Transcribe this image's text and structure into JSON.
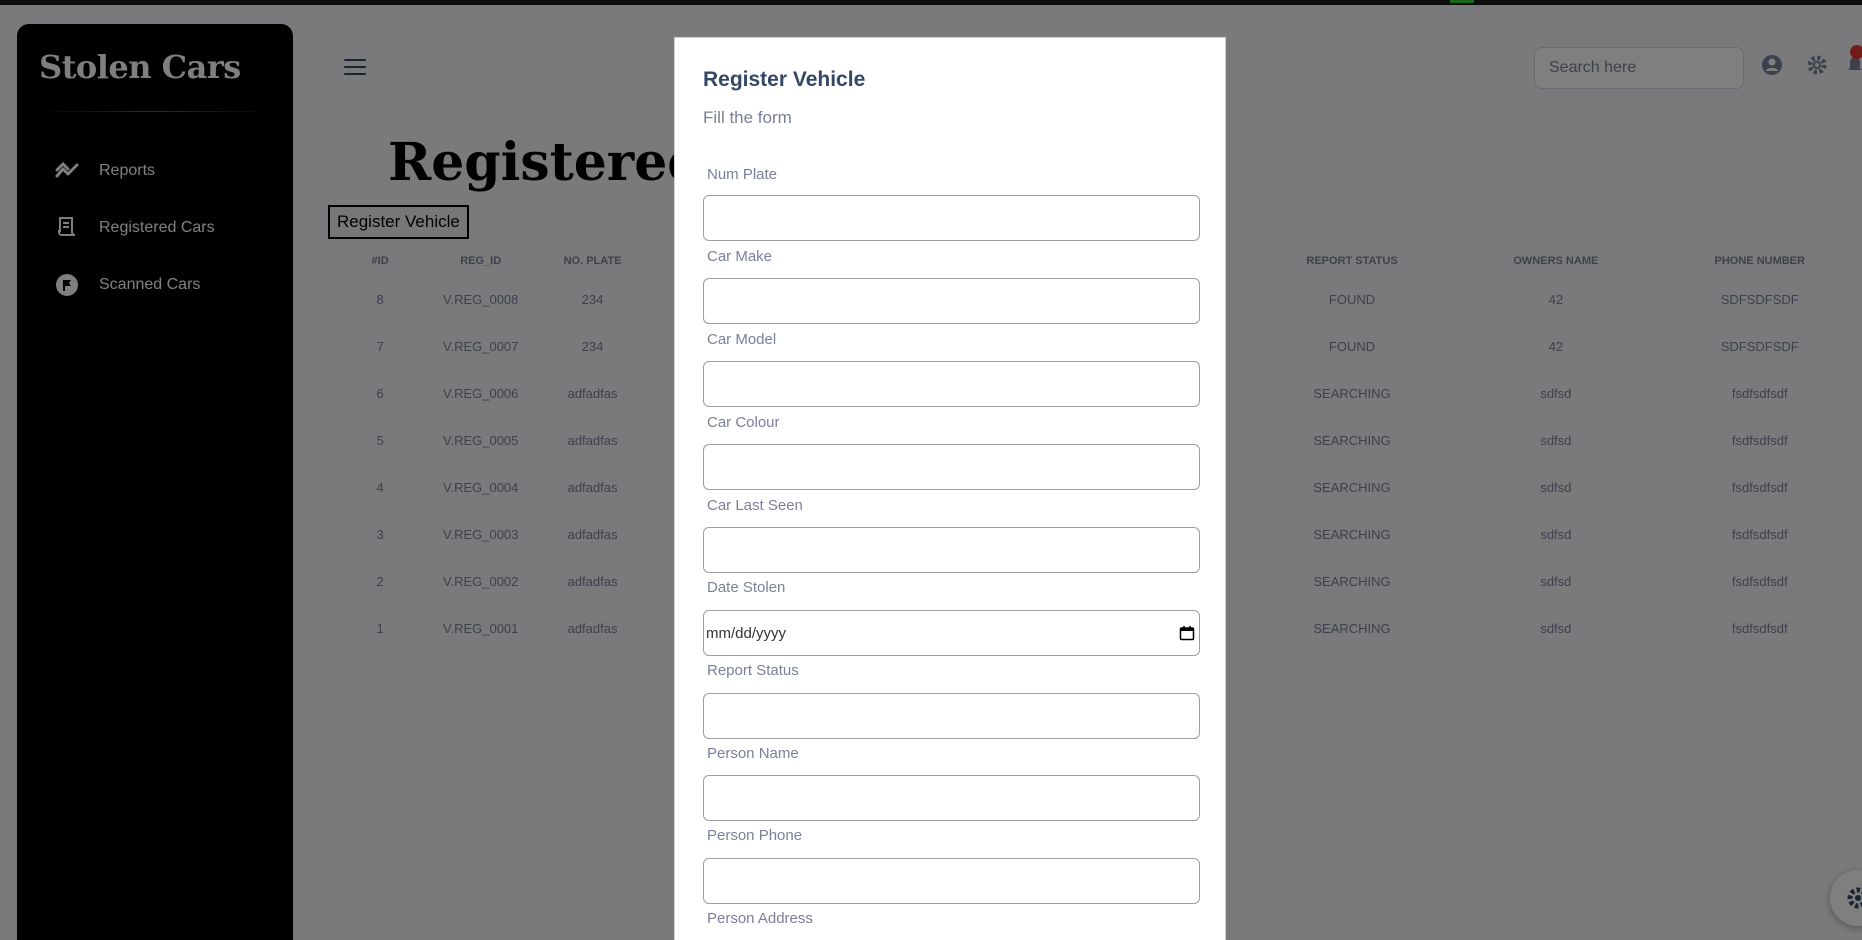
{
  "sidebar": {
    "brand": "Stolen Cars",
    "items": [
      {
        "label": "Reports",
        "icon": "chart-line-icon"
      },
      {
        "label": "Registered Cars",
        "icon": "receipt-icon"
      },
      {
        "label": "Scanned Cars",
        "icon": "flag-icon"
      }
    ]
  },
  "header": {
    "title": "Registered V",
    "register_button": "Register Vehicle",
    "search_placeholder": "Search here"
  },
  "table": {
    "columns": [
      "#ID",
      "REG_ID",
      "NO. PLATE",
      "REPORT STATUS",
      "OWNERS NAME",
      "PHONE NUMBER"
    ],
    "rows": [
      {
        "id": "8",
        "reg_id": "V.REG_0008",
        "plate": "234",
        "status": "FOUND",
        "owner": "42",
        "phone": "SDFSDFSDF"
      },
      {
        "id": "7",
        "reg_id": "V.REG_0007",
        "plate": "234",
        "status": "FOUND",
        "owner": "42",
        "phone": "SDFSDFSDF"
      },
      {
        "id": "6",
        "reg_id": "V.REG_0006",
        "plate": "adfadfas",
        "status": "SEARCHING",
        "owner": "sdfsd",
        "phone": "fsdfsdfsdf"
      },
      {
        "id": "5",
        "reg_id": "V.REG_0005",
        "plate": "adfadfas",
        "status": "SEARCHING",
        "owner": "sdfsd",
        "phone": "fsdfsdfsdf"
      },
      {
        "id": "4",
        "reg_id": "V.REG_0004",
        "plate": "adfadfas",
        "status": "SEARCHING",
        "owner": "sdfsd",
        "phone": "fsdfsdfsdf"
      },
      {
        "id": "3",
        "reg_id": "V.REG_0003",
        "plate": "adfadfas",
        "status": "SEARCHING",
        "owner": "sdfsd",
        "phone": "fsdfsdfsdf"
      },
      {
        "id": "2",
        "reg_id": "V.REG_0002",
        "plate": "adfadfas",
        "status": "SEARCHING",
        "owner": "sdfsd",
        "phone": "fsdfsdfsdf"
      },
      {
        "id": "1",
        "reg_id": "V.REG_0001",
        "plate": "adfadfas",
        "status": "SEARCHING",
        "owner": "sdfsd",
        "phone": "fsdfsdfsdf"
      }
    ]
  },
  "modal": {
    "title": "Register Vehicle",
    "subtitle": "Fill the form",
    "fields": [
      {
        "label": "Num Plate",
        "value": ""
      },
      {
        "label": "Car Make",
        "value": ""
      },
      {
        "label": "Car Model",
        "value": ""
      },
      {
        "label": "Car Colour",
        "value": ""
      },
      {
        "label": "Car Last Seen",
        "value": ""
      },
      {
        "label": "Date Stolen",
        "value": "mm/dd/yyyy"
      },
      {
        "label": "Report Status",
        "value": ""
      },
      {
        "label": "Person Name",
        "value": ""
      },
      {
        "label": "Person Phone",
        "value": ""
      },
      {
        "label": "Person Address",
        "value": ""
      }
    ]
  },
  "colors": {
    "sidebar_bg": "#000000",
    "overlay": "rgba(0,0,0,0.5)",
    "heading": "#344767",
    "muted": "#7b809a",
    "notification": "#e53935"
  }
}
